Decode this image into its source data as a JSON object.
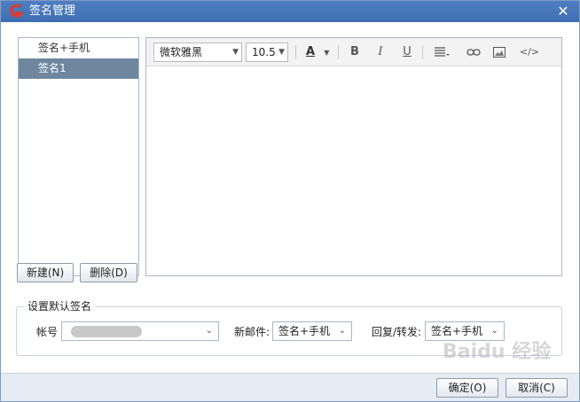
{
  "window": {
    "title": "签名管理",
    "close_label": "✕"
  },
  "signatures": {
    "items": [
      {
        "label": "签名+手机",
        "selected": false
      },
      {
        "label": "签名1",
        "selected": true
      }
    ]
  },
  "toolbar": {
    "font_family": "微软雅黑",
    "font_size": "10.5",
    "font_color_label": "A",
    "bold_label": "B",
    "italic_label": "I",
    "underline_label": "U",
    "align_icon": "align-icon",
    "link_icon": "link-icon",
    "image_icon": "image-icon",
    "source_label": "</>"
  },
  "buttons": {
    "new_label": "新建(N)",
    "delete_label": "删除(D)",
    "ok_label": "确定(O)",
    "cancel_label": "取消(C)"
  },
  "default_signature": {
    "group_title": "设置默认签名",
    "account_label": "帐号",
    "account_value": "",
    "new_mail_label": "新邮件:",
    "new_mail_value": "签名+手机",
    "reply_label": "回复/转发:",
    "reply_value": "签名+手机"
  },
  "watermark": "Baidu 经验",
  "colors": {
    "title_bar": "#3f6eb2",
    "selected_item": "#6e879f",
    "logo": "#e03a2e"
  }
}
